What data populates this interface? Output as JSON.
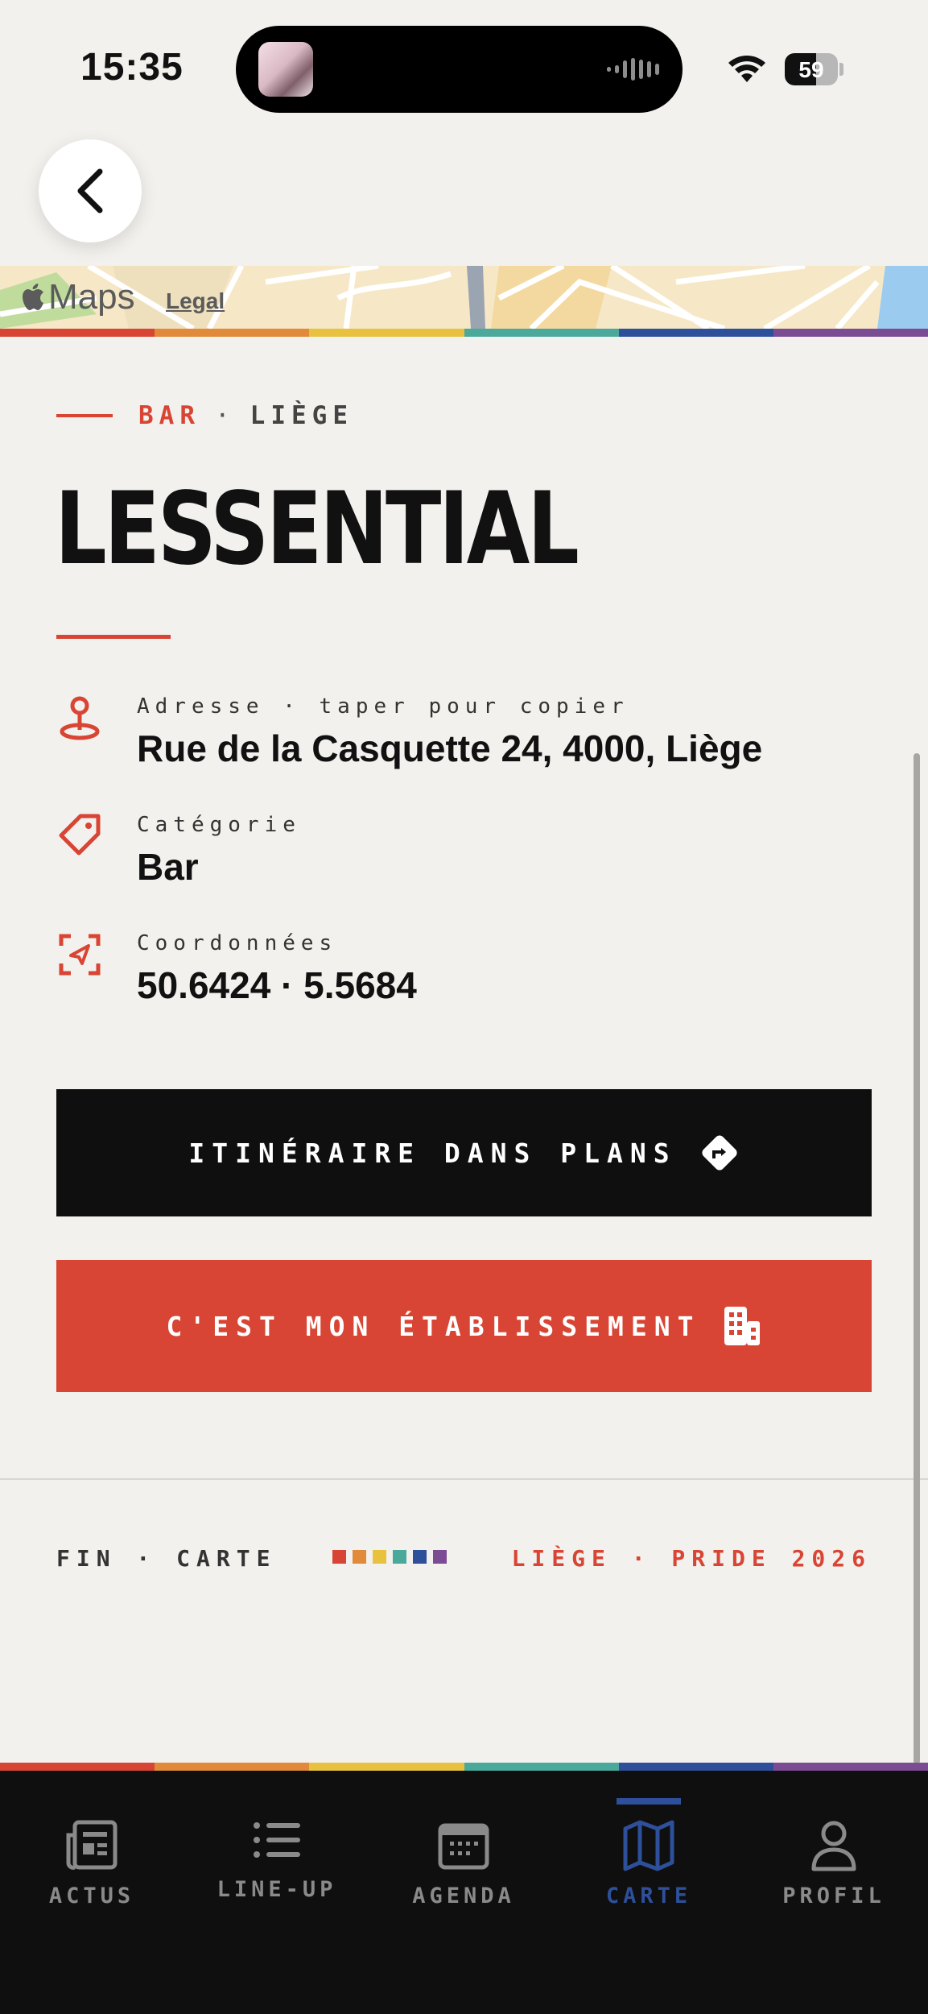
{
  "status_bar": {
    "time": "15:35",
    "battery_level": "59",
    "icons": [
      "now-playing-artwork",
      "audio-waveform-icon",
      "wifi-icon",
      "battery-icon"
    ]
  },
  "map": {
    "attribution_brand": "Maps",
    "legal_label": "Legal"
  },
  "rainbow_colors": [
    "#d84534",
    "#e08a3a",
    "#e8c23f",
    "#4aa99b",
    "#2e4f9a",
    "#7b4c94"
  ],
  "venue": {
    "category": "BAR",
    "separator": "·",
    "city": "LIÈGE",
    "name": "LESSENTIAL"
  },
  "details": {
    "address_label": "Adresse · taper pour copier",
    "address_value": "Rue de la Casquette 24, 4000, Liège",
    "category_label": "Catégorie",
    "category_value": "Bar",
    "coords_label": "Coordonnées",
    "coords_value": "50.6424 · 5.5684"
  },
  "actions": {
    "directions_label": "ITINÉRAIRE DANS PLANS",
    "claim_label": "C'EST MON ÉTABLISSEMENT"
  },
  "footer": {
    "left": "FIN · CARTE",
    "right": "LIÈGE · PRIDE 2026"
  },
  "tabs": [
    {
      "label": "ACTUS",
      "icon": "newspaper-icon",
      "active": false
    },
    {
      "label": "LINE-UP",
      "icon": "list-icon",
      "active": false
    },
    {
      "label": "AGENDA",
      "icon": "calendar-icon",
      "active": false
    },
    {
      "label": "CARTE",
      "icon": "map-icon",
      "active": true
    },
    {
      "label": "PROFIL",
      "icon": "person-icon",
      "active": false
    }
  ],
  "colors": {
    "accent_red": "#d84534",
    "active_tab_blue": "#2e4f9a",
    "background": "#f3f1ed",
    "dark": "#0f0f0f"
  }
}
